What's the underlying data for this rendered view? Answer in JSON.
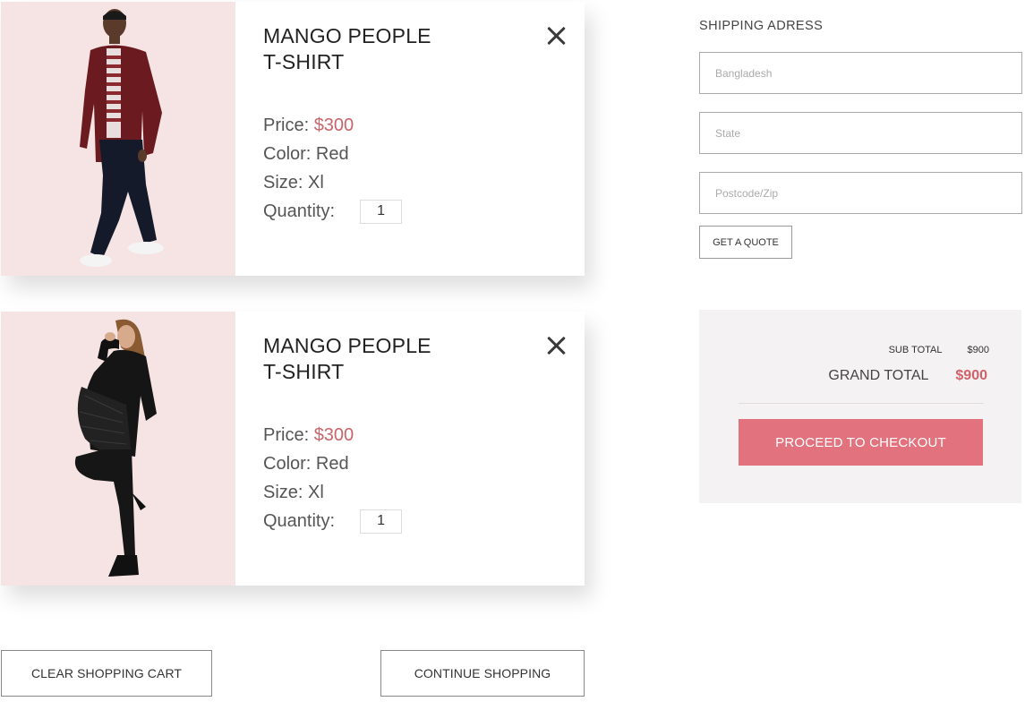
{
  "cart": {
    "items": [
      {
        "title_line1": "MANGO PEOPLE",
        "title_line2": "T-SHIRT",
        "price_label": "Price:",
        "price_value": "$300",
        "color_label": "Color: Red",
        "size_label": "Size: Xl",
        "quantity_label": "Quantity:",
        "quantity_value": "1",
        "image_description": "man in red plaid shirt walking"
      },
      {
        "title_line1": "MANGO PEOPLE",
        "title_line2": "T-SHIRT",
        "price_label": "Price:",
        "price_value": "$300",
        "color_label": "Color: Red",
        "size_label": "Size: Xl",
        "quantity_label": "Quantity:",
        "quantity_value": "1",
        "image_description": "woman in black outfit posing"
      }
    ],
    "clear_label": "CLEAR SHOPPING CART",
    "continue_label": "CONTINUE SHOPPING"
  },
  "shipping": {
    "title": "SHIPPING ADRESS",
    "country_placeholder": "Bangladesh",
    "state_placeholder": "State",
    "zip_placeholder": "Postcode/Zip",
    "quote_label": "GET A QUOTE"
  },
  "summary": {
    "subtotal_label": "SUB TOTAL",
    "subtotal_value": "$900",
    "grand_label": "GRAND TOTAL",
    "grand_value": "$900",
    "checkout_label": "PROCEED TO CHECKOUT"
  },
  "colors": {
    "accent": "#e2737e",
    "price": "#c8646a",
    "image_bg": "#f5e4e3"
  }
}
